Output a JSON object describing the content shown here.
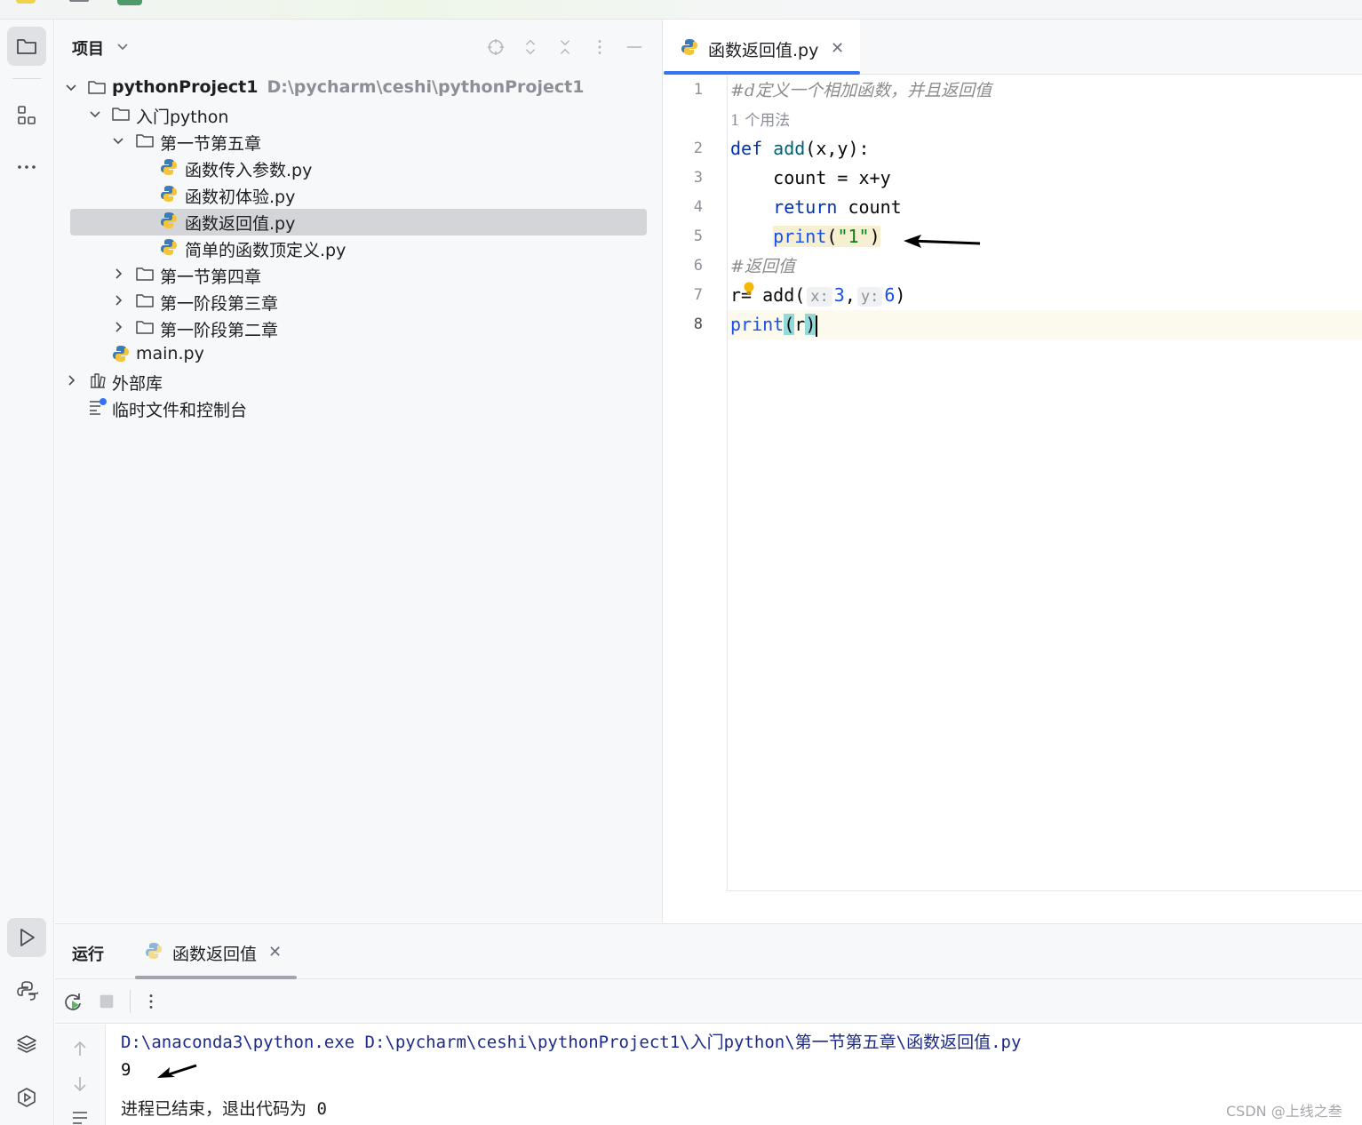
{
  "project_panel": {
    "title": "项目",
    "tree": [
      {
        "label": "pythonProject1",
        "path": "D:\\pycharm\\ceshi\\pythonProject1",
        "type": "folder",
        "expanded": true
      },
      {
        "label": "入门python",
        "type": "folder",
        "expanded": true
      },
      {
        "label": "第一节第五章",
        "type": "folder",
        "expanded": true
      },
      {
        "label": "函数传入参数.py",
        "type": "python-file"
      },
      {
        "label": "函数初体验.py",
        "type": "python-file"
      },
      {
        "label": "函数返回值.py",
        "type": "python-file",
        "selected": true
      },
      {
        "label": "简单的函数顶定义.py",
        "type": "python-file"
      },
      {
        "label": "第一节第四章",
        "type": "folder",
        "expanded": false
      },
      {
        "label": "第一阶段第三章",
        "type": "folder",
        "expanded": false
      },
      {
        "label": "第一阶段第二章",
        "type": "folder",
        "expanded": false
      },
      {
        "label": "main.py",
        "type": "python-file"
      },
      {
        "label": "外部库",
        "type": "library",
        "expanded": false
      },
      {
        "label": "临时文件和控制台",
        "type": "scratches"
      }
    ]
  },
  "editor": {
    "tab_label": "函数返回值.py",
    "usage_hint": "1 个用法",
    "line_numbers": [
      "1",
      "2",
      "3",
      "4",
      "5",
      "6",
      "7",
      "8"
    ],
    "lines": {
      "l1_comment": "#d定义一个相加函数，并且返回值",
      "l2_def": "def",
      "l2_name": "add",
      "l2_rest": "(x,y):",
      "l3": "    count = x+y",
      "l4_kw": "return",
      "l4_rest": " count",
      "l5_fn": "print",
      "l5_open": "(",
      "l5_str": "\"1\"",
      "l5_close": ")",
      "l6_comment": "#返回值",
      "l7_var": "r",
      "l7_eq": "= add(",
      "l7_hint_x": "x:",
      "l7_val_x": "3",
      "l7_comma": ",",
      "l7_hint_y": "y:",
      "l7_val_y": "6",
      "l7_close": ")",
      "l8_fn": "print",
      "l8_open": "(",
      "l8_arg": "r",
      "l8_close": ")"
    }
  },
  "run_panel": {
    "label": "运行",
    "tab_label": "函数返回值",
    "command": "D:\\anaconda3\\python.exe D:\\pycharm\\ceshi\\pythonProject1\\入门python\\第一节第五章\\函数返回值.py",
    "output": "9",
    "exit_message": "进程已结束，退出代码为 0"
  },
  "watermark": "CSDN @上线之叁",
  "colors": {
    "accent": "#3574f0",
    "keyword": "#0033b3",
    "string": "#067d17",
    "comment": "#8c8c8c",
    "selection": "#d4d5d8"
  }
}
